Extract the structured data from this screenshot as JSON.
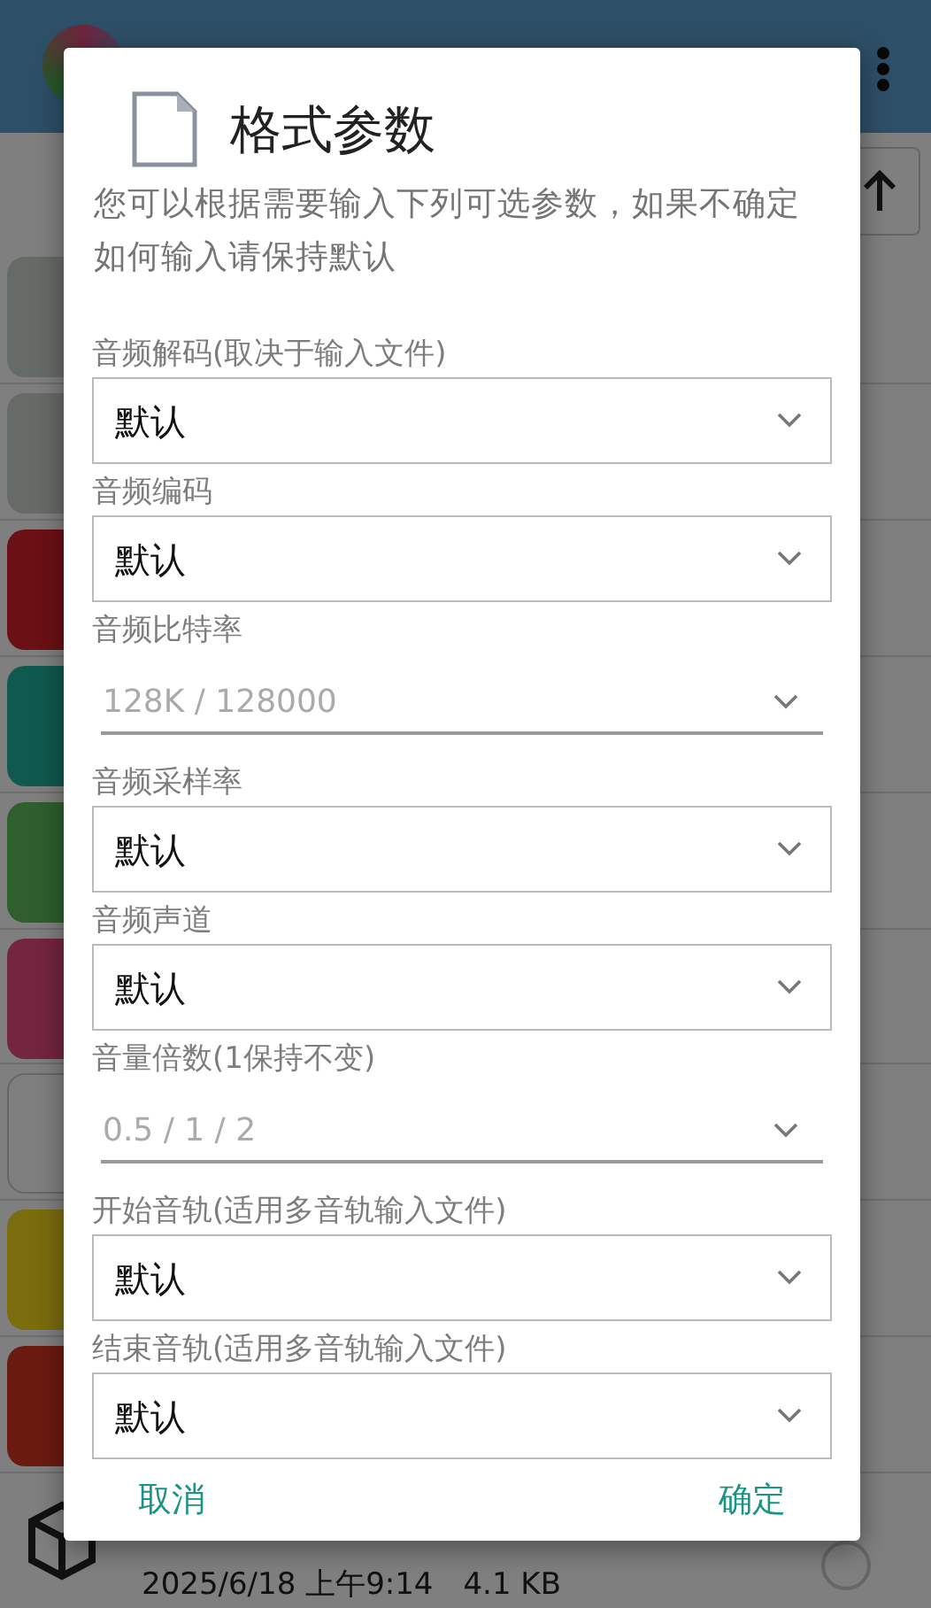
{
  "background": {
    "last_file": {
      "date": "2025/6/18 上午9:14",
      "size": "4.1 KB",
      "checked": false
    }
  },
  "dialog": {
    "title": "格式参数",
    "description": "您可以根据需要输入下列可选参数，如果不确定如何输入请保持默认",
    "fields": [
      {
        "label": "音频解码(取决于输入文件)",
        "kind": "select",
        "value": "默认"
      },
      {
        "label": "音频编码",
        "kind": "select",
        "value": "默认"
      },
      {
        "label": "音频比特率",
        "kind": "input",
        "placeholder": "128K / 128000"
      },
      {
        "label": "音频采样率",
        "kind": "select",
        "value": "默认"
      },
      {
        "label": "音频声道",
        "kind": "select",
        "value": "默认"
      },
      {
        "label": "音量倍数(1保持不变)",
        "kind": "input",
        "placeholder": "0.5 / 1 / 2"
      },
      {
        "label": "开始音轨(适用多音轨输入文件)",
        "kind": "select",
        "value": "默认"
      },
      {
        "label": "结束音轨(适用多音轨输入文件)",
        "kind": "select",
        "value": "默认"
      }
    ],
    "buttons": [
      "取消",
      "确定"
    ]
  }
}
